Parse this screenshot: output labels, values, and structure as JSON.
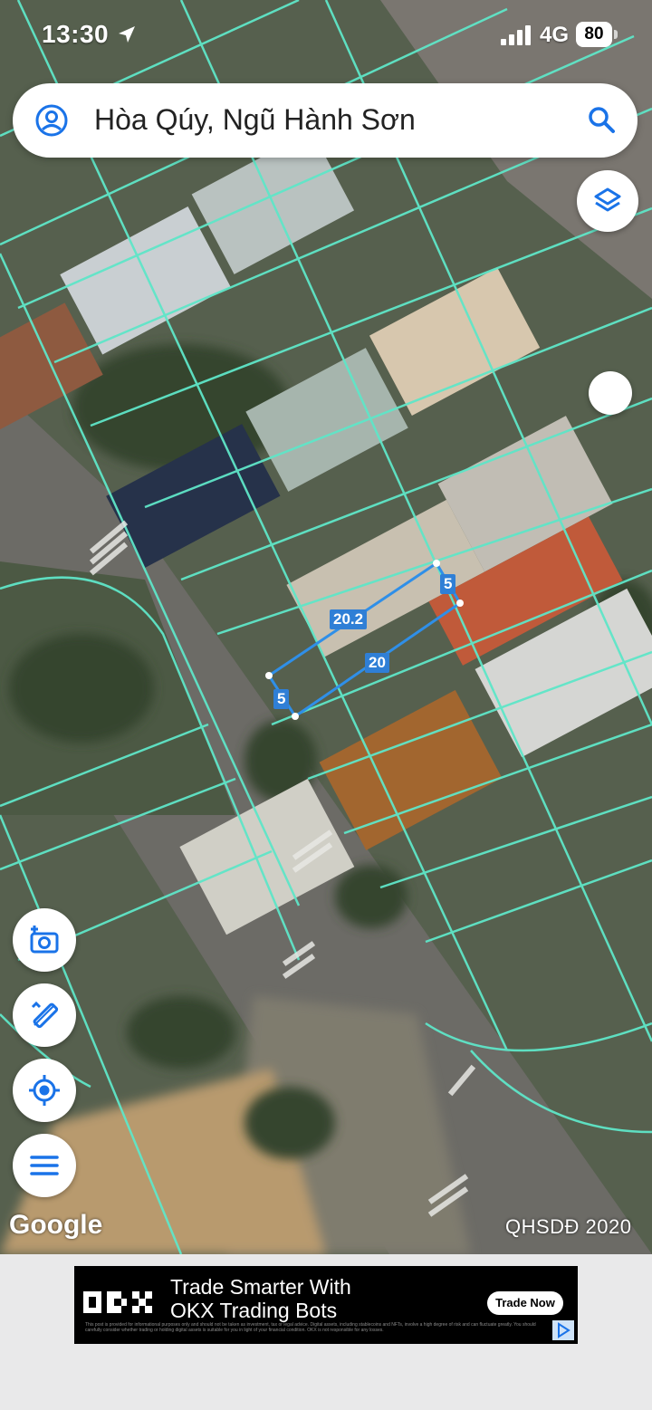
{
  "status_bar": {
    "time": "13:30",
    "network": "4G",
    "battery": "80"
  },
  "search": {
    "text": "Hòa Qúy, Ngũ Hành Sơn"
  },
  "map": {
    "attribution": "Google",
    "layer_label": "QHSDĐ 2020",
    "measurements": {
      "top_edge": "20.2",
      "bottom_edge": "20",
      "right_edge": "5",
      "left_edge": "5"
    }
  },
  "icons": {
    "account": "account-circle-icon",
    "search": "search-icon",
    "layers": "layers-icon",
    "camera": "add-photo-icon",
    "measure": "measure-icon",
    "location": "my-location-icon",
    "menu": "menu-icon"
  },
  "colors": {
    "accent": "#2f7fd6",
    "parcel_lines": "#5fe6c8",
    "measure_line": "#2f8fe8"
  },
  "ad": {
    "brand": "OKX",
    "title_line1": "Trade Smarter With",
    "title_line2": "OKX Trading Bots",
    "cta": "Trade Now",
    "fine_print": "This post is provided for informational purposes only and should not be taken as investment, tax or legal advice. Digital assets, including stablecoins and NFTs, involve a high degree of risk and can fluctuate greatly. You should carefully consider whether trading or holding digital assets is suitable for you in light of your financial condition. OKX is not responsible for any losses."
  }
}
